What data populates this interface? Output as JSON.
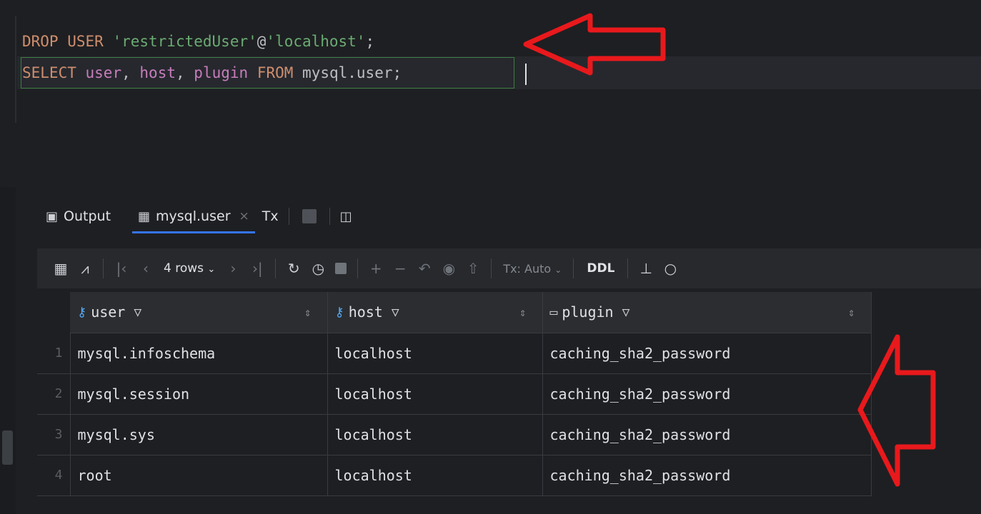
{
  "editor": {
    "line1": {
      "kw1": "DROP USER",
      "str": "'restrictedUser'",
      "at": "@",
      "str2": "'localhost'",
      "end": ";"
    },
    "line2": {
      "kw1": "SELECT",
      "col1": "user",
      "comma1": ",",
      "col2": "host",
      "comma2": ",",
      "col3": "plugin",
      "kw2": "FROM",
      "table": "mysql.user",
      "end": ";"
    }
  },
  "results": {
    "tabs": {
      "output_label": "Output",
      "table_tab_label": "mysql.user",
      "close_glyph": "×",
      "tx_label": "Tx"
    },
    "toolbar": {
      "rows_label": "4 rows",
      "tx_mode": "Tx: Auto",
      "ddl_label": "DDL"
    },
    "columns": [
      "user",
      "host",
      "plugin"
    ],
    "rows": [
      {
        "num": "1",
        "user": "mysql.infoschema",
        "host": "localhost",
        "plugin": "caching_sha2_password"
      },
      {
        "num": "2",
        "user": "mysql.session",
        "host": "localhost",
        "plugin": "caching_sha2_password"
      },
      {
        "num": "3",
        "user": "mysql.sys",
        "host": "localhost",
        "plugin": "caching_sha2_password"
      },
      {
        "num": "4",
        "user": "root",
        "host": "localhost",
        "plugin": "caching_sha2_password"
      }
    ]
  },
  "annotations": {
    "arrow_color": "#e8191c"
  }
}
